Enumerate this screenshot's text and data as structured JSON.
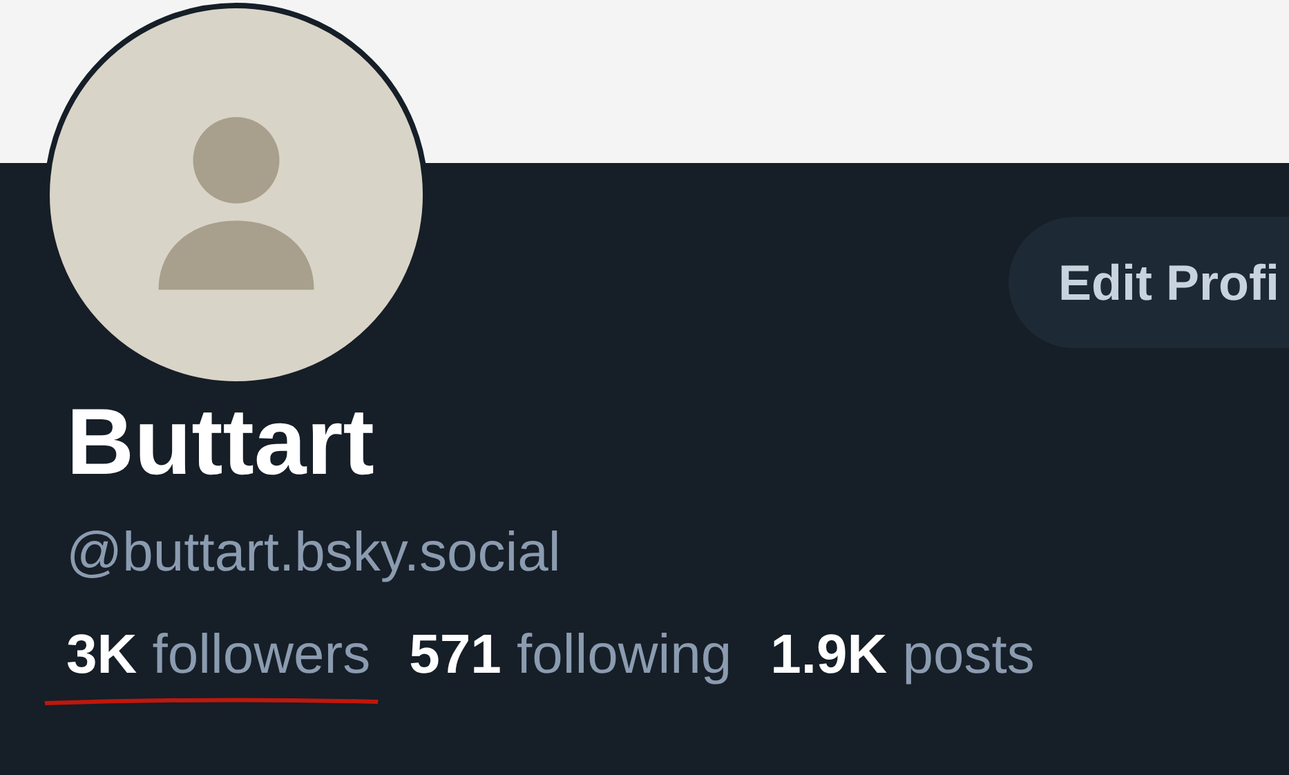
{
  "profile": {
    "edit_button": {
      "label": "Edit Profi"
    },
    "name": "Buttart",
    "handle": "@buttart.bsky.social",
    "stats": [
      {
        "text": "**3K** followers",
        "underlined": true
      },
      {
        "text": "**571** following",
        "underlined": false
      },
      {
        "text": "**1.9K** posts",
        "underlined": false
      }
    ]
  }
}
